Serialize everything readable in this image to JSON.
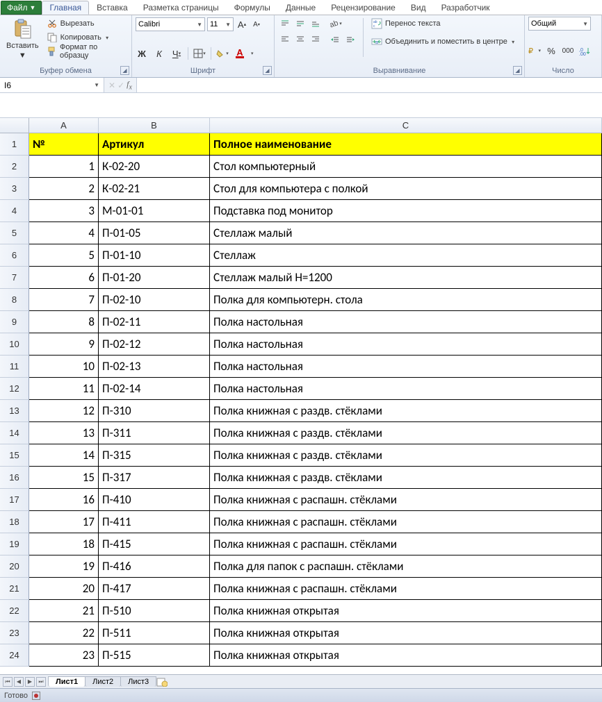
{
  "tabs": {
    "file": "Файл",
    "items": [
      "Главная",
      "Вставка",
      "Разметка страницы",
      "Формулы",
      "Данные",
      "Рецензирование",
      "Вид",
      "Разработчик"
    ],
    "active": 0
  },
  "ribbon": {
    "clipboard": {
      "paste": "Вставить",
      "cut": "Вырезать",
      "copy": "Копировать",
      "format_painter": "Формат по образцу",
      "group": "Буфер обмена"
    },
    "font": {
      "name": "Calibri",
      "size": "11",
      "group": "Шрифт"
    },
    "align": {
      "wrap": "Перенос текста",
      "merge": "Объединить и поместить в центре",
      "group": "Выравнивание"
    },
    "number": {
      "format": "Общий",
      "group": "Число"
    }
  },
  "namebox": "I6",
  "formula": "",
  "columns": [
    "A",
    "B",
    "C"
  ],
  "header_row": {
    "num": "№",
    "art": "Артикул",
    "name": "Полное наименование"
  },
  "rows": [
    {
      "n": 1,
      "art": "К-02-20",
      "name": "Стол компьютерный"
    },
    {
      "n": 2,
      "art": "К-02-21",
      "name": "Стол для компьютера с полкой"
    },
    {
      "n": 3,
      "art": "М-01-01",
      "name": "Подставка под монитор"
    },
    {
      "n": 4,
      "art": "П-01-05",
      "name": "Стеллаж малый"
    },
    {
      "n": 5,
      "art": "П-01-10",
      "name": "Стеллаж"
    },
    {
      "n": 6,
      "art": "П-01-20",
      "name": "Стеллаж малый Н=1200"
    },
    {
      "n": 7,
      "art": "П-02-10",
      "name": "Полка для компьютерн. стола"
    },
    {
      "n": 8,
      "art": "П-02-11",
      "name": "Полка настольная"
    },
    {
      "n": 9,
      "art": "П-02-12",
      "name": "Полка настольная"
    },
    {
      "n": 10,
      "art": "П-02-13",
      "name": "Полка настольная"
    },
    {
      "n": 11,
      "art": "П-02-14",
      "name": "Полка настольная"
    },
    {
      "n": 12,
      "art": "П-310",
      "name": "Полка книжная с раздв. стёклами"
    },
    {
      "n": 13,
      "art": "П-311",
      "name": "Полка книжная с раздв. стёклами"
    },
    {
      "n": 14,
      "art": "П-315",
      "name": "Полка книжная с раздв. стёклами"
    },
    {
      "n": 15,
      "art": "П-317",
      "name": "Полка книжная с раздв. стёклами"
    },
    {
      "n": 16,
      "art": "П-410",
      "name": "Полка книжная с распашн. стёклами"
    },
    {
      "n": 17,
      "art": "П-411",
      "name": "Полка книжная с распашн. стёклами"
    },
    {
      "n": 18,
      "art": "П-415",
      "name": "Полка книжная с распашн. стёклами"
    },
    {
      "n": 19,
      "art": "П-416",
      "name": "Полка для папок с распашн. стёклами"
    },
    {
      "n": 20,
      "art": "П-417",
      "name": "Полка книжная с распашн. стёклами"
    },
    {
      "n": 21,
      "art": "П-510",
      "name": "Полка книжная открытая"
    },
    {
      "n": 22,
      "art": "П-511",
      "name": "Полка книжная открытая"
    },
    {
      "n": 23,
      "art": "П-515",
      "name": "Полка книжная открытая"
    }
  ],
  "sheets": {
    "items": [
      "Лист1",
      "Лист2",
      "Лист3"
    ],
    "active": 0
  },
  "status": "Готово"
}
